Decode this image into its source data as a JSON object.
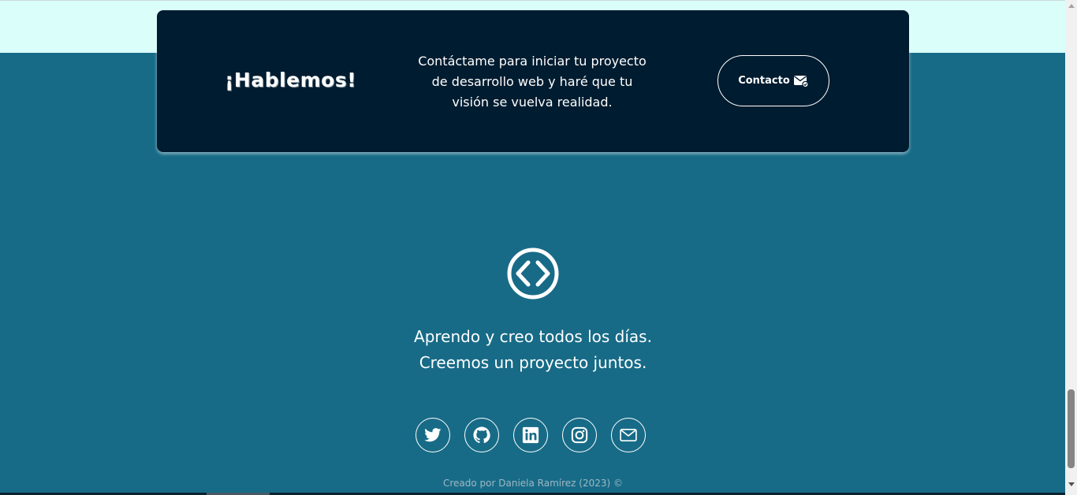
{
  "cta": {
    "title": "¡Hablemos!",
    "description": "Contáctame para iniciar tu proyecto de desarrollo web y haré que tu visión se vuelva realidad.",
    "button_label": "Contacto"
  },
  "footer": {
    "logo_icon": "code-brackets-icon",
    "tagline_line1": "Aprendo y creo todos los días.",
    "tagline_line2": "Creemos un proyecto juntos.",
    "socials": [
      {
        "name": "twitter",
        "icon": "twitter-icon"
      },
      {
        "name": "github",
        "icon": "github-icon"
      },
      {
        "name": "linkedin",
        "icon": "linkedin-icon"
      },
      {
        "name": "instagram",
        "icon": "instagram-icon"
      },
      {
        "name": "email",
        "icon": "mail-icon"
      }
    ],
    "credit": "Creado por Daniela Ramírez (2023) ©"
  },
  "colors": {
    "top_strip": "#dafffb",
    "page_background": "#176b87",
    "card_background": "#001c30",
    "text": "#ffffff",
    "credit_text": "#9fb8c4"
  }
}
